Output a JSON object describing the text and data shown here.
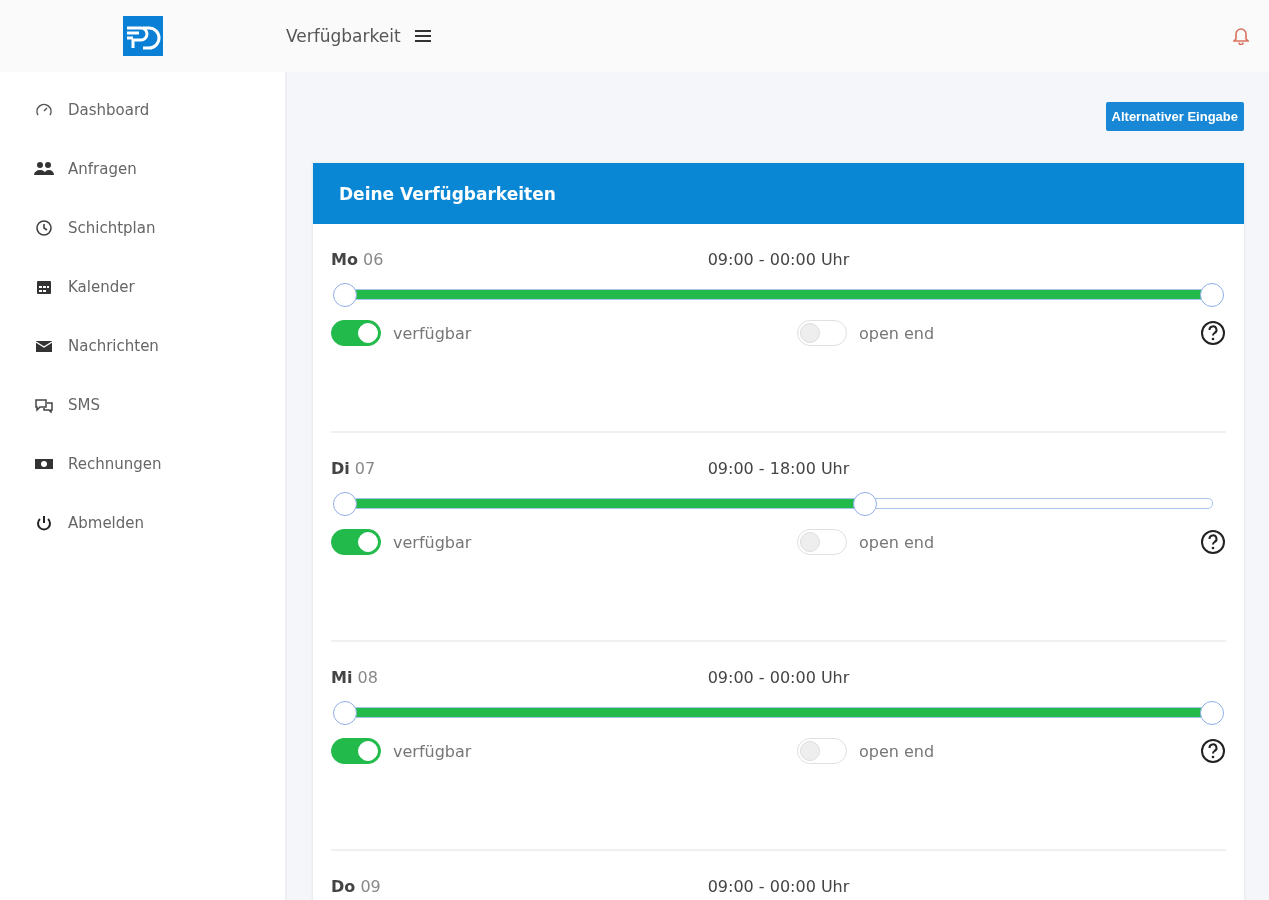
{
  "header": {
    "title": "Verfügbarkeit"
  },
  "sidebar": {
    "items": [
      {
        "label": "Dashboard"
      },
      {
        "label": "Anfragen"
      },
      {
        "label": "Schichtplan"
      },
      {
        "label": "Kalender"
      },
      {
        "label": "Nachrichten"
      },
      {
        "label": "SMS"
      },
      {
        "label": "Rechnungen"
      },
      {
        "label": "Abmelden"
      }
    ]
  },
  "alt_button": "Alternativer Eingabe",
  "card": {
    "title": "Deine Verfügbarkeiten",
    "days": [
      {
        "day": "Mo",
        "date": "06",
        "time": "09:00 - 00:00 Uhr",
        "thumbs": [
          {
            "level": 0
          },
          {
            "level": 1
          }
        ],
        "available": {
          "label": "verfügbar",
          "on": true
        },
        "open_end": {
          "label": "open end",
          "on": false
        }
      },
      {
        "day": "Di",
        "date": "07",
        "time": "09:00 - 18:00 Uhr",
        "thumbs": [
          {
            "level": 0
          },
          {
            "level": 0.6
          }
        ],
        "available": {
          "label": "verfügbar",
          "on": true
        },
        "open_end": {
          "label": "open end",
          "on": false
        }
      },
      {
        "day": "Mi",
        "date": "08",
        "time": "09:00 - 00:00 Uhr",
        "thumbs": [
          {
            "level": 0
          },
          {
            "level": 1
          }
        ],
        "available": {
          "label": "verfügbar",
          "on": true
        },
        "open_end": {
          "label": "open end",
          "on": false
        }
      },
      {
        "day": "Do",
        "date": "09",
        "time": "09:00 - 00:00 Uhr"
      }
    ]
  }
}
